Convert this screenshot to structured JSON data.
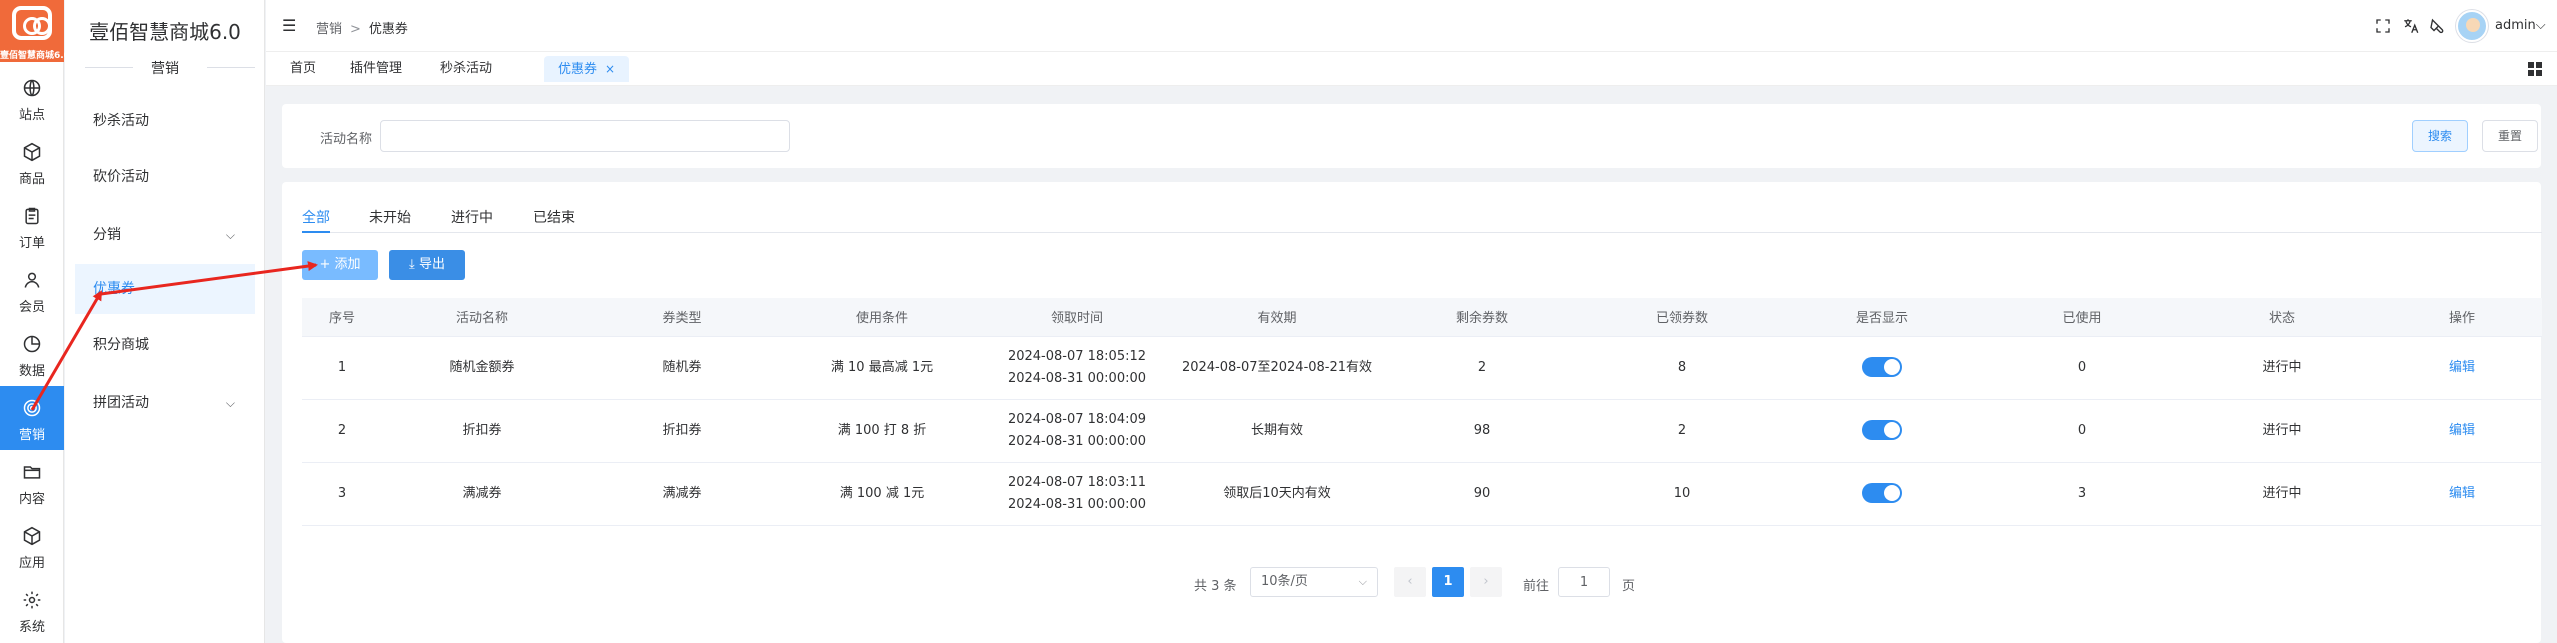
{
  "app": {
    "logo_text": "壹佰智慧商城6.0",
    "brand": "壹佰智慧商城6.0",
    "accent": "#2d8cf0",
    "logo_color": "#f06a3a"
  },
  "rail": [
    {
      "label": "站点",
      "icon": "globe-icon"
    },
    {
      "label": "商品",
      "icon": "cube-icon"
    },
    {
      "label": "订单",
      "icon": "clipboard-icon"
    },
    {
      "label": "会员",
      "icon": "user-icon"
    },
    {
      "label": "数据",
      "icon": "pie-chart-icon"
    },
    {
      "label": "营销",
      "icon": "target-icon",
      "active": true
    },
    {
      "label": "内容",
      "icon": "folder-icon"
    },
    {
      "label": "应用",
      "icon": "box-icon"
    },
    {
      "label": "系统",
      "icon": "gear-icon"
    }
  ],
  "submenu": {
    "section": "营销",
    "items": [
      {
        "label": "秒杀活动"
      },
      {
        "label": "砍价活动"
      },
      {
        "label": "分销",
        "expandable": true
      },
      {
        "label": "优惠券",
        "active": true
      },
      {
        "label": "积分商城"
      },
      {
        "label": "拼团活动",
        "expandable": true
      }
    ]
  },
  "header": {
    "breadcrumb": [
      "营销",
      "优惠券"
    ],
    "separator": ">",
    "username": "admin",
    "icons": [
      "fullscreen-icon",
      "translate-icon",
      "theme-icon"
    ]
  },
  "tabs": [
    {
      "label": "首页"
    },
    {
      "label": "插件管理"
    },
    {
      "label": "秒杀活动"
    },
    {
      "label": "优惠券",
      "active": true,
      "closable": true
    }
  ],
  "search": {
    "label": "活动名称",
    "value": "",
    "placeholder": "",
    "search_btn": "搜索",
    "reset_btn": "重置"
  },
  "status_tabs": [
    {
      "label": "全部",
      "active": true
    },
    {
      "label": "未开始"
    },
    {
      "label": "进行中"
    },
    {
      "label": "已结束"
    }
  ],
  "actions": {
    "add": "添加",
    "export": "导出",
    "add_icon": "+",
    "export_icon": "⤓"
  },
  "table": {
    "columns": [
      "序号",
      "活动名称",
      "券类型",
      "使用条件",
      "领取时间",
      "有效期",
      "剩余券数",
      "已领券数",
      "是否显示",
      "已使用",
      "状态",
      "操作"
    ],
    "rows": [
      {
        "no": "1",
        "name": "随机金额券",
        "type": "随机券",
        "cond": "满 10 最高减 1元",
        "t1": "2024-08-07 18:05:12",
        "t2": "2024-08-31 00:00:00",
        "valid": "2024-08-07至2024-08-21有效",
        "remain": "2",
        "taken": "8",
        "show": true,
        "used": "0",
        "status": "进行中",
        "op": "编辑"
      },
      {
        "no": "2",
        "name": "折扣券",
        "type": "折扣券",
        "cond": "满 100 打 8 折",
        "t1": "2024-08-07 18:04:09",
        "t2": "2024-08-31 00:00:00",
        "valid": "长期有效",
        "remain": "98",
        "taken": "2",
        "show": true,
        "used": "0",
        "status": "进行中",
        "op": "编辑"
      },
      {
        "no": "3",
        "name": "满减券",
        "type": "满减券",
        "cond": "满 100 减 1元",
        "t1": "2024-08-07 18:03:11",
        "t2": "2024-08-31 00:00:00",
        "valid": "领取后10天内有效",
        "remain": "90",
        "taken": "10",
        "show": true,
        "used": "3",
        "status": "进行中",
        "op": "编辑"
      }
    ]
  },
  "pagination": {
    "total": "共 3 条",
    "page_size": "10条/页",
    "current": "1",
    "prev": "‹",
    "next": "›",
    "goto_label": "前往",
    "goto_value": "1",
    "page_suffix": "页"
  }
}
